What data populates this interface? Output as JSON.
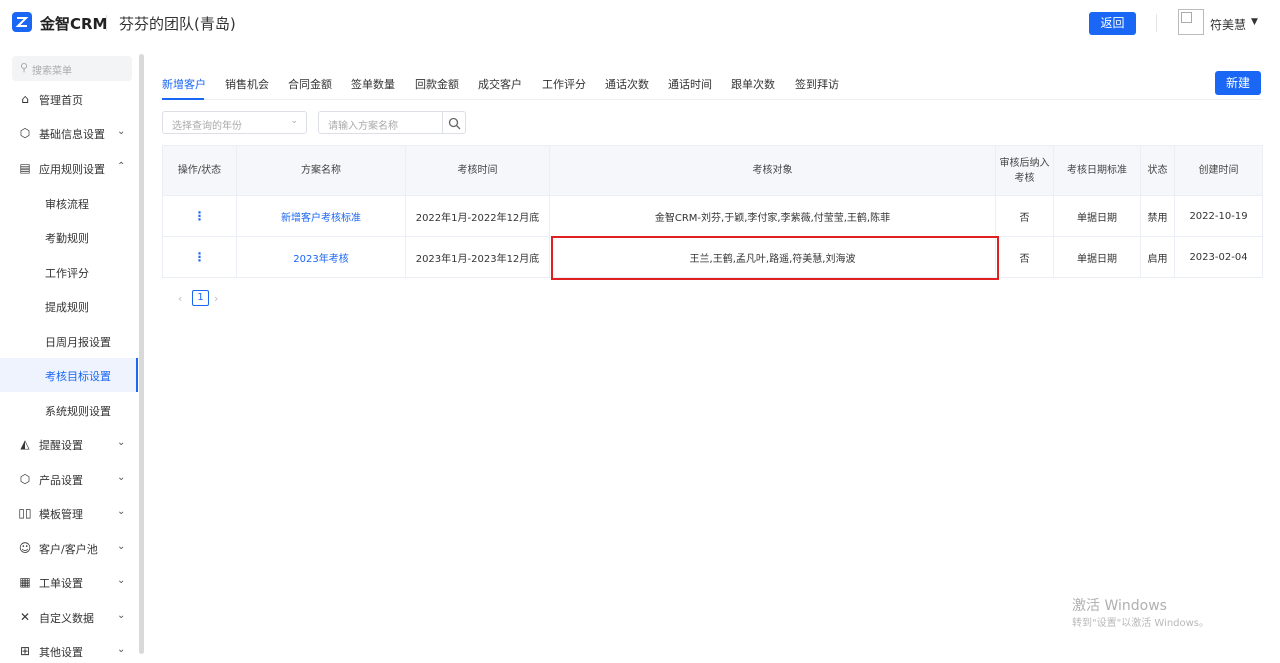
{
  "header": {
    "brand": "金智CRM",
    "team": "芬芬的团队(青岛)",
    "back_label": "返回",
    "username": "符美慧"
  },
  "sidebar": {
    "search_placeholder": "搜索菜单",
    "items": [
      {
        "label": "管理首页",
        "icon": "home-icon"
      },
      {
        "label": "基础信息设置",
        "icon": "cube-icon"
      },
      {
        "label": "应用规则设置",
        "icon": "document-icon"
      },
      {
        "label": "提醒设置",
        "icon": "bell-icon"
      },
      {
        "label": "产品设置",
        "icon": "product-icon"
      },
      {
        "label": "模板管理",
        "icon": "template-icon"
      },
      {
        "label": "客户/客户池",
        "icon": "customer-icon"
      },
      {
        "label": "工单设置",
        "icon": "ticket-icon"
      },
      {
        "label": "自定义数据",
        "icon": "tools-icon"
      },
      {
        "label": "其他设置",
        "icon": "grid-icon"
      }
    ],
    "sub_items": [
      "审核流程",
      "考勤规则",
      "工作评分",
      "提成规则",
      "日周月报设置",
      "考核目标设置",
      "系统规则设置"
    ],
    "active_sub": "考核目标设置"
  },
  "tabs": [
    "新增客户",
    "销售机会",
    "合同金额",
    "签单数量",
    "回款金额",
    "成交客户",
    "工作评分",
    "通话次数",
    "通话时间",
    "跟单次数",
    "签到拜访"
  ],
  "active_tab": "新增客户",
  "new_label": "新建",
  "filters": {
    "year_placeholder": "选择查询的年份",
    "plan_placeholder": "请输入方案名称"
  },
  "table": {
    "headers": [
      "操作/状态",
      "方案名称",
      "考核时间",
      "考核对象",
      "审核后纳入考核",
      "考核日期标准",
      "状态",
      "创建时间"
    ],
    "rows": [
      {
        "ops": "⋮",
        "name": "新增客户考核标准",
        "period": "2022年1月-2022年12月底",
        "targets": "金智CRM-刘芬,于颖,李付家,李紫薇,付莹莹,王鹤,陈菲",
        "review": "否",
        "date_std": "单据日期",
        "status": "禁用",
        "created": "2022-10-19"
      },
      {
        "ops": "⋮",
        "name": "2023年考核",
        "period": "2023年1月-2023年12月底",
        "targets": "王兰,王鹤,孟凡叶,路遥,符美慧,刘海波",
        "review": "否",
        "date_std": "单据日期",
        "status": "启用",
        "created": "2023-02-04"
      }
    ]
  },
  "pagination": {
    "current": "1"
  },
  "watermark": {
    "line1": "激活 Windows",
    "line2": "转到\"设置\"以激活 Windows。"
  },
  "colors": {
    "accent": "#1a66f5",
    "highlight": "#e02020"
  }
}
